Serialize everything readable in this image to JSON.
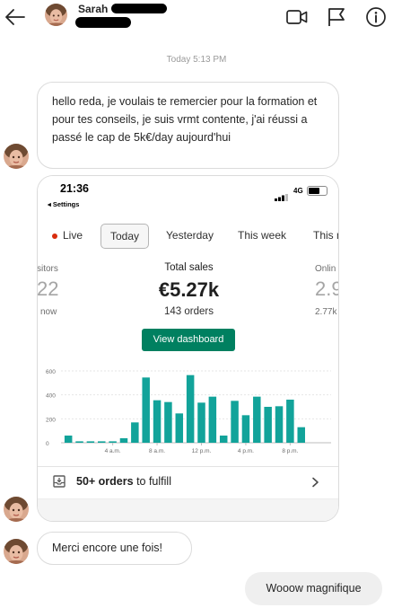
{
  "header": {
    "contact_name": "Sarah",
    "icons": [
      "back-arrow-icon",
      "video-call-icon",
      "flag-icon",
      "info-icon"
    ]
  },
  "thread": {
    "timestamp": "Today 5:13 PM",
    "message1": " hello reda, je voulais te remercier pour la formation et pour tes conseils, je suis vrmt contente, j'ai réussi a passé le cap de 5k€/day aujourd'hui",
    "message2": "Merci encore une fois!",
    "reply": "Wooow magnifique"
  },
  "screenshot": {
    "status_bar": {
      "time": "21:36",
      "back_label": "◂ Settings",
      "network": "4G"
    },
    "tabs": [
      "Live",
      "Today",
      "Yesterday",
      "This week",
      "This m"
    ],
    "selected_tab": "Today",
    "metrics": {
      "left_label": "sitors",
      "left_value": "22",
      "left_sub": "now",
      "total_sales_label": "Total sales",
      "total_sales_value": "€5.27k",
      "total_sales_orders": "143 orders",
      "right_label": "Onlin",
      "right_value": "2.9",
      "right_sub": "2.77k"
    },
    "view_button": "View dashboard",
    "fulfill": {
      "bold": "50+ orders",
      "rest": " to fulfill"
    },
    "colors": {
      "primary": "#008060",
      "bar": "#12a39a",
      "live_dot": "#d82c0d"
    }
  },
  "chart_data": {
    "type": "bar",
    "title": "",
    "xlabel": "",
    "ylabel": "",
    "ylim": [
      0,
      600
    ],
    "y_ticks": [
      "600",
      "400",
      "200",
      "0"
    ],
    "x_tick_labels": [
      "4 a.m.",
      "8 a.m.",
      "12 p.m.",
      "4 p.m.",
      "8 p.m."
    ],
    "x_tick_hours": [
      4,
      8,
      12,
      16,
      20
    ],
    "hours": [
      0,
      1,
      2,
      3,
      4,
      5,
      6,
      7,
      8,
      9,
      10,
      11,
      12,
      13,
      14,
      15,
      16,
      17,
      18,
      19,
      20,
      21,
      22
    ],
    "values": [
      60,
      12,
      12,
      12,
      12,
      38,
      170,
      545,
      355,
      340,
      245,
      565,
      335,
      385,
      60,
      350,
      230,
      385,
      300,
      305,
      360,
      130,
      0
    ]
  }
}
